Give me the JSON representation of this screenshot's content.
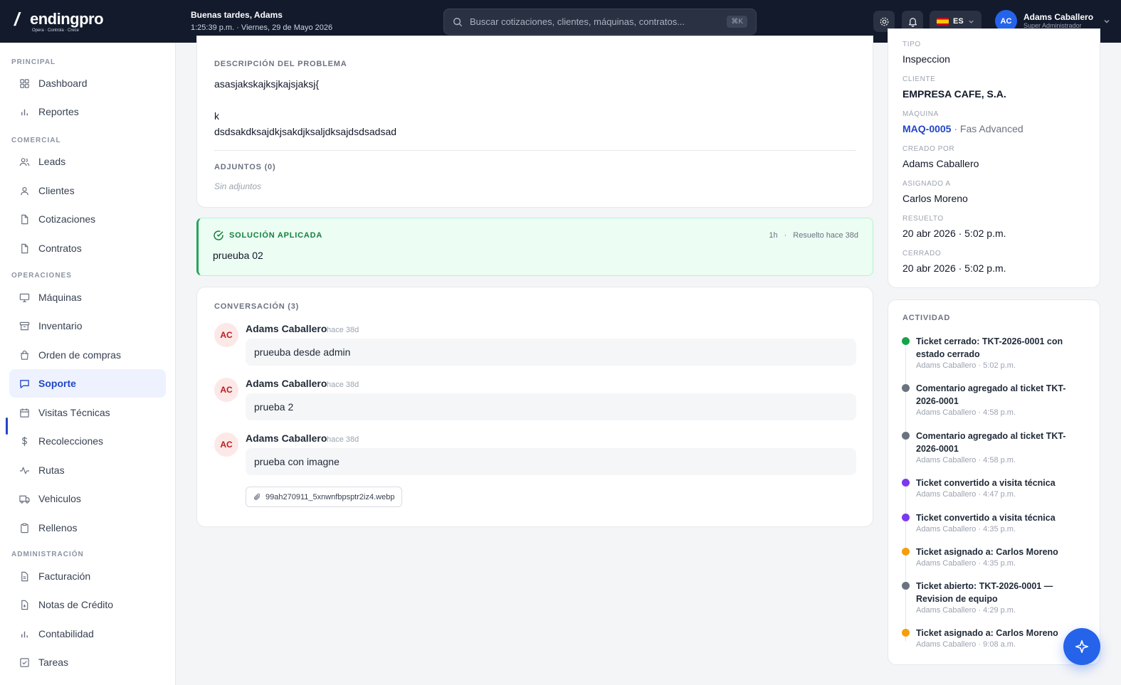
{
  "brand": {
    "mark": "/",
    "word": "endingpro",
    "tagline": "Opera · Controla · Crece"
  },
  "header": {
    "greeting": "Buenas tardes, Adams",
    "datetime": "1:25:39 p.m. · Viernes, 29 de Mayo 2026",
    "search_placeholder": "Buscar cotizaciones, clientes, máquinas, contratos...",
    "search_shortcut": "⌘K",
    "lang": "ES",
    "user_initials": "AC",
    "user_name": "Adams Caballero",
    "user_role": "Super Administrador"
  },
  "sidebar": {
    "sections": [
      "PRINCIPAL",
      "COMERCIAL",
      "OPERACIONES",
      "ADMINISTRACIÓN"
    ],
    "items": [
      {
        "label": "Dashboard",
        "icon": "grid-icon"
      },
      {
        "label": "Reportes",
        "icon": "bar-chart-icon"
      },
      {
        "label": "Leads",
        "icon": "users-icon"
      },
      {
        "label": "Clientes",
        "icon": "user-icon"
      },
      {
        "label": "Cotizaciones",
        "icon": "file-icon"
      },
      {
        "label": "Contratos",
        "icon": "file-icon"
      },
      {
        "label": "Máquinas",
        "icon": "monitor-icon"
      },
      {
        "label": "Inventario",
        "icon": "archive-icon"
      },
      {
        "label": "Orden de compras",
        "icon": "shopping-bag-icon"
      },
      {
        "label": "Soporte",
        "icon": "message-icon"
      },
      {
        "label": "Visitas Técnicas",
        "icon": "calendar-icon"
      },
      {
        "label": "Recolecciones",
        "icon": "dollar-icon"
      },
      {
        "label": "Rutas",
        "icon": "activity-icon"
      },
      {
        "label": "Vehiculos",
        "icon": "truck-icon"
      },
      {
        "label": "Rellenos",
        "icon": "clipboard-icon"
      },
      {
        "label": "Facturación",
        "icon": "file-text-icon"
      },
      {
        "label": "Notas de Crédito",
        "icon": "file-plus-icon"
      },
      {
        "label": "Contabilidad",
        "icon": "bar-chart-icon"
      },
      {
        "label": "Tareas",
        "icon": "check-square-icon"
      }
    ],
    "active": "Soporte"
  },
  "description": {
    "title": "DESCRIPCIÓN DEL PROBLEMA",
    "lines": [
      "asasjakskajksjkajsjaksj{",
      "",
      "k",
      "dsdsakdksajdkjsakdjksaljdksajdsdsadsad"
    ],
    "attachments_title": "ADJUNTOS (0)",
    "attachments_empty": "Sin adjuntos"
  },
  "solution": {
    "title": "SOLUCIÓN APLICADA",
    "duration": "1h",
    "sep": "·",
    "resolved": "Resuelto hace 38d",
    "text": "prueuba 02"
  },
  "conversation": {
    "title": "CONVERSACIÓN (3)",
    "messages": [
      {
        "initials": "AC",
        "author": "Adams Caballero",
        "when": "hace 38d",
        "text": "prueuba desde admin"
      },
      {
        "initials": "AC",
        "author": "Adams Caballero",
        "when": "hace 38d",
        "text": "prueba 2"
      },
      {
        "initials": "AC",
        "author": "Adams Caballero",
        "when": "hace 38d",
        "text": "prueba con imagne",
        "attachment": "99ah270911_5xnwnfbpsptr2iz4.webp"
      }
    ]
  },
  "details": {
    "tipo_label": "TIPO",
    "tipo": "Inspeccion",
    "cliente_label": "CLIENTE",
    "cliente": "EMPRESA CAFE, S.A.",
    "maquina_label": "MÁQUINA",
    "maquina_code": "MAQ-0005",
    "maquina_name": "· Fas Advanced",
    "creado_label": "CREADO POR",
    "creado": "Adams Caballero",
    "asignado_label": "ASIGNADO A",
    "asignado": "Carlos Moreno",
    "resuelto_label": "RESUELTO",
    "resuelto": "20 abr 2026 · 5:02 p.m.",
    "cerrado_label": "CERRADO",
    "cerrado": "20 abr 2026 · 5:02 p.m."
  },
  "activity": {
    "title": "ACTIVIDAD",
    "items": [
      {
        "text": "Ticket cerrado: TKT-2026-0001 con estado cerrado",
        "sub": "Adams Caballero · 5:02 p.m.",
        "color": "#16a34a"
      },
      {
        "text": "Comentario agregado al ticket TKT-2026-0001",
        "sub": "Adams Caballero · 4:58 p.m.",
        "color": "#6b7280"
      },
      {
        "text": "Comentario agregado al ticket TKT-2026-0001",
        "sub": "Adams Caballero · 4:58 p.m.",
        "color": "#6b7280"
      },
      {
        "text": "Ticket convertido a visita técnica",
        "sub": "Adams Caballero · 4:47 p.m.",
        "color": "#7c3aed"
      },
      {
        "text": "Ticket convertido a visita técnica",
        "sub": "Adams Caballero · 4:35 p.m.",
        "color": "#7c3aed"
      },
      {
        "text": "Ticket asignado a: Carlos Moreno",
        "sub": "Adams Caballero · 4:35 p.m.",
        "color": "#f59e0b"
      },
      {
        "text": "Ticket abierto: TKT-2026-0001 — Revision de equipo",
        "sub": "Adams Caballero · 4:29 p.m.",
        "color": "#6b7280"
      },
      {
        "text": "Ticket asignado a: Carlos Moreno",
        "sub": "Adams Caballero · 9:08 a.m.",
        "color": "#f59e0b"
      }
    ]
  },
  "colors": {
    "accent": "#2563eb",
    "topbar": "#121a2c",
    "success": "#22a55b"
  }
}
